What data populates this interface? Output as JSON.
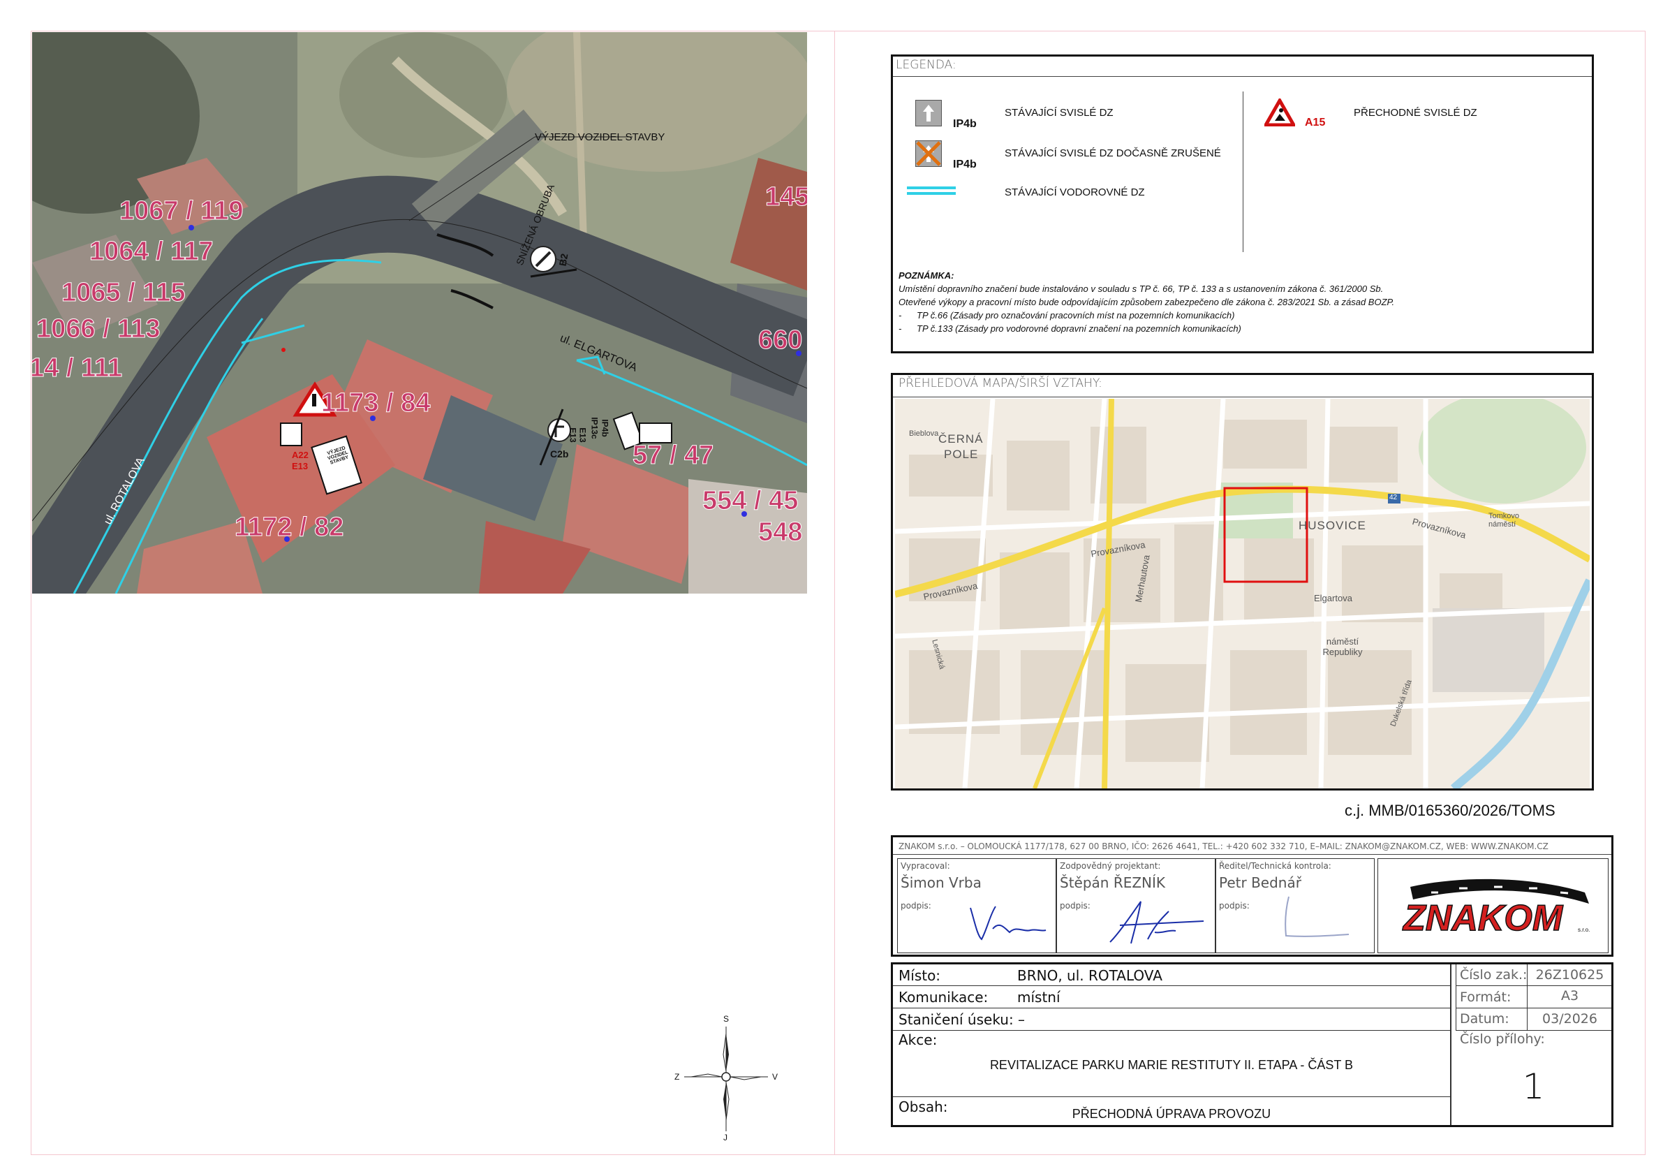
{
  "aerial": {
    "parcels": [
      "1067 / 119",
      "1064 / 117",
      "1065 / 115",
      "1066 / 113",
      "14 / 111",
      "1173 / 84",
      "1172 / 82",
      "57 / 47",
      "554 / 45",
      "548",
      "660",
      "145"
    ],
    "streets": [
      "ul. ROTALOVA",
      "ul. ELGARTOVA"
    ],
    "annotations": [
      "VÝJEZD VOZIDEL STAVBY",
      "SNÍŽENÁ OBRUBA"
    ],
    "sign_codes": [
      "B2",
      "C2b",
      "IP4b",
      "IP13c",
      "E13",
      "E13",
      "A22",
      "E13"
    ],
    "sign_plate_text": "VÝJEZD VOZIDEL STAVBY"
  },
  "legend": {
    "title": "LEGENDA:",
    "items": [
      {
        "code": "IP4b",
        "text": "STÁVAJÍCÍ SVISLÉ DZ"
      },
      {
        "code": "IP4b",
        "text": "STÁVAJÍCÍ SVISLÉ DZ DOČASNĚ ZRUŠENÉ"
      },
      {
        "code": "",
        "text": "STÁVAJÍCÍ VODOROVNÉ DZ"
      },
      {
        "code": "A15",
        "text": "PŘECHODNÉ SVISLÉ DZ"
      }
    ],
    "note_title": "POZNÁMKA:",
    "note_lines": [
      "Umístění dopravního značení bude instalováno v souladu s TP č. 66, TP č. 133 a s ustanovením zákona č. 361/2000 Sb.",
      "Otevřené výkopy a pracovní místo bude odpovídajícím způsobem zabezpečeno dle zákona č. 283/2021 Sb. a zásad BOZP.",
      "-      TP č.66 (Zásady pro označování pracovních míst na pozemních komunikacích)",
      "-      TP č.133 (Zásady pro vodorovné dopravní značení na pozemních komunikacích)"
    ]
  },
  "overview": {
    "title": "PŘEHLEDOVÁ MAPA/ŠIRŠÍ VZTAHY:",
    "labels": [
      "ČERNÁ",
      "POLE",
      "HUSOVICE",
      "Provazníkova",
      "Provazníkova",
      "Provazníkova",
      "Merhautova",
      "Elgartova",
      "náměstí Republiky",
      "Tomkovo náměstí",
      "Dukelská třída",
      "Lesnická",
      "Bieblova"
    ],
    "road_badge": "42"
  },
  "ref_number": "c.j. MMB/0165360/2026/TOMS",
  "company_line": "ZNAKOM s.r.o. – OLOMOUCKÁ 1177/178, 627 00 BRNO, IČO: 2626 4641, TEL.: +420 602 332 710, E–MAIL: ZNAKOM@ZNAKOM.CZ, WEB: WWW.ZNAKOM.CZ",
  "signatures": [
    {
      "role": "Vypracoval:",
      "name": "Šimon Vrba",
      "sign_label": "podpis:"
    },
    {
      "role": "Zodpovědný projektant:",
      "name": "Štěpán ŘEZNÍK",
      "sign_label": "podpis:"
    },
    {
      "role": "Ředitel/Technická kontrola:",
      "name": "Petr Bednář",
      "sign_label": "podpis:"
    }
  ],
  "logo": {
    "text": "ZNAKOM",
    "suffix": "s.r.o."
  },
  "info": {
    "misto_label": "Místo:",
    "misto_value": "BRNO, ul. ROTALOVA",
    "komunikace_label": "Komunikace:",
    "komunikace_value": "místní",
    "staniceni_label": "Staničení úseku: –",
    "akce_label": "Akce:",
    "akce_value": "REVITALIZACE PARKU MARIE RESTITUTY II. ETAPA - ČÁST B",
    "obsah_label": "Obsah:",
    "obsah_value": "PŘECHODNÁ ÚPRAVA PROVOZU",
    "cislo_zak_label": "Číslo zak.:",
    "cislo_zak_value": "26Z10625",
    "format_label": "Formát:",
    "format_value": "A3",
    "datum_label": "Datum:",
    "datum_value": "03/2026",
    "cislo_prilohy_label": "Číslo přílohy:",
    "cislo_prilohy_value": "1"
  },
  "compass": {
    "n": "S",
    "s": "J",
    "w": "Z",
    "e": "V"
  },
  "colors": {
    "marking": "#2fd0e6",
    "sign_red": "#d01010",
    "logo_red": "#d42020",
    "frame_pink": "#f4c6cf",
    "overview_highlight": "#e01010"
  }
}
